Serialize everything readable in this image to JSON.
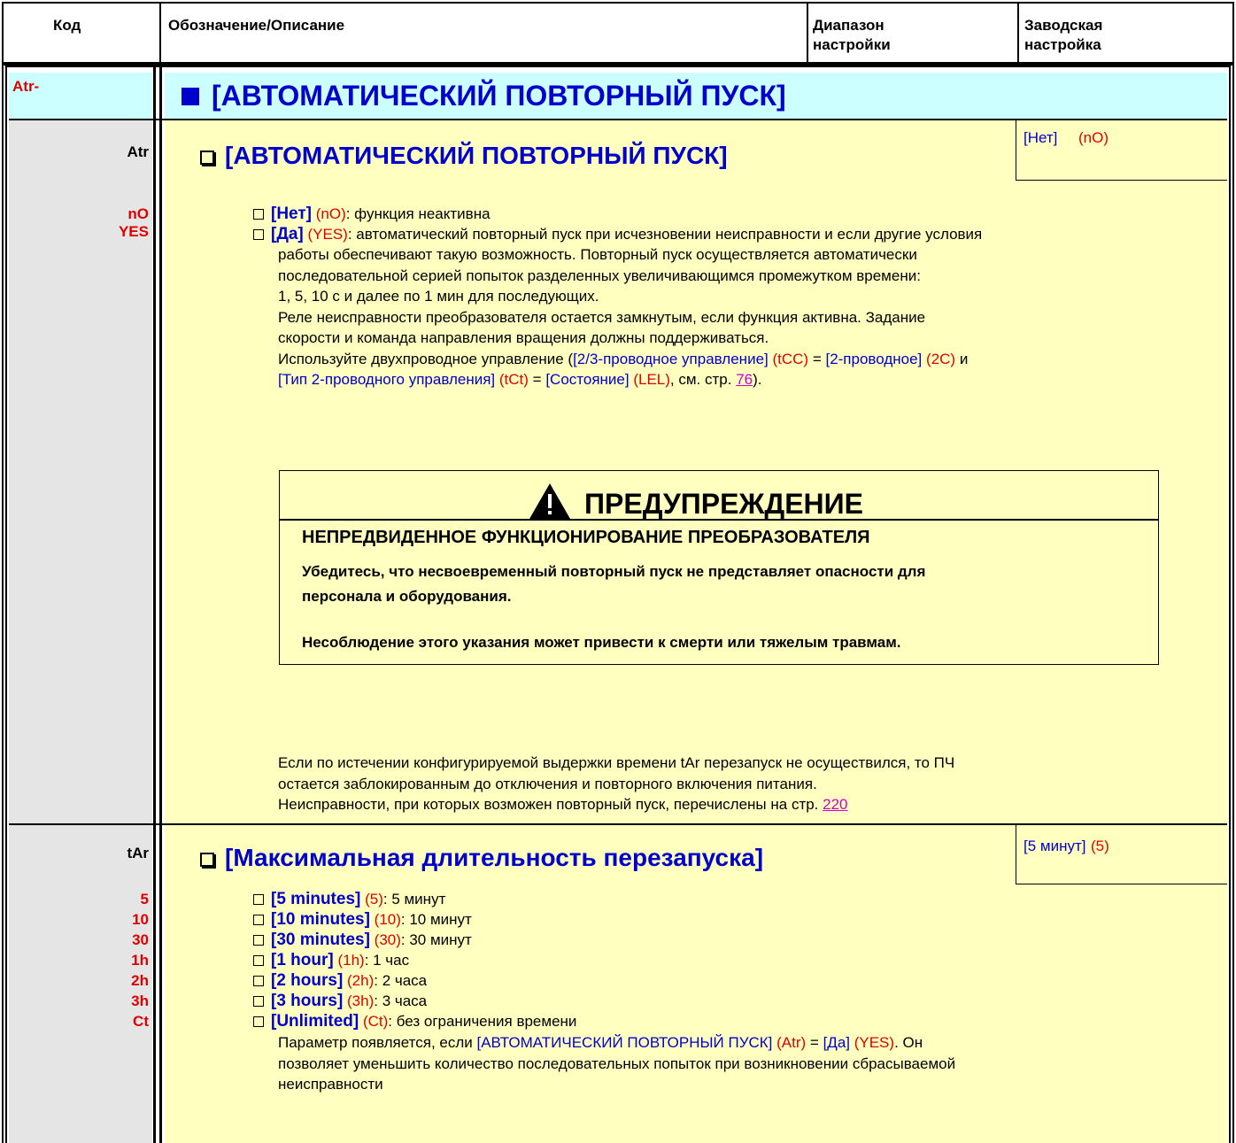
{
  "colors": {
    "yellow": "#ffffc0",
    "gray": "#e5e5e5",
    "cyan": "#ccffff",
    "blue": "#0000cc",
    "red": "#e00000",
    "link": "#cc00cc"
  },
  "header": {
    "col1": "Код",
    "col2": "Обозначение/Описание",
    "col3_line1": "Диапазон",
    "col3_line2": "настройки",
    "col4_line1": "Заводская",
    "col4_line2": "настройка"
  },
  "menu": {
    "code": "Atr-",
    "title": "[АВТОМАТИЧЕСКИЙ ПОВТОРНЫЙ ПУСК]"
  },
  "atr": {
    "code": "Atr",
    "codes": [
      "nO",
      "YES"
    ],
    "title": "[АВТОМАТИЧЕСКИЙ ПОВТОРНЫЙ ПУСК]",
    "factory_label": "[Нет]",
    "factory_code": "(nO)",
    "opt_no_label": "[Нет]",
    "opt_no_code": "(nO)",
    "opt_no_desc": ":  функция неактивна",
    "opt_yes_label": "[Да]",
    "opt_yes_code": "(YES)",
    "opt_yes_desc": ": автоматический повторный пуск при исчезновении неисправности и если другие условия",
    "lines": [
      "работы обеспечивают такую возможность. Повторный пуск осуществляется автоматически",
      "последовательной серией попыток разделенных увеличивающимся промежутком времени:",
      "1, 5, 10 с и далее по 1 мин для последующих.",
      "Реле неисправности преобразователя остается замкнутым, если функция активна. Задание",
      "скорости и команда направления вращения должны поддерживаться."
    ],
    "wire": {
      "p1": "Используйте двухпроводное управление (",
      "l1": "[2/3-проводное управление]",
      "c1": "(tCC)",
      "eq1": " = ",
      "l2": "[2-проводное]",
      "c2": "(2C)",
      "and": " и",
      "l3": "[Тип 2-проводного управления]",
      "c3": "(tCt)",
      "eq2": " = ",
      "l4": "[Состояние]",
      "c4": "(LEL)",
      "see": ", см. стр. ",
      "page": "76",
      "end": ")."
    },
    "warning": {
      "title": "ПРЕДУПРЕЖДЕНИЕ",
      "heading": "НЕПРЕДВИДЕННОЕ ФУНКЦИОНИРОВАНИЕ ПРЕОБРАЗОВАТЕЛЯ",
      "line1": "Убедитесь, что несвоевременный повторный пуск не представляет опасности для",
      "line2": "персонала и оборудования.",
      "line3": "Несоблюдение этого указания может привести к смерти или тяжелым травмам."
    },
    "after1": "Если по истечении конфигурируемой выдержки времени tAr перезапуск не осуществился, то ПЧ",
    "after2": "остается заблокированным до отключения и повторного включения питания.",
    "after3": "Неисправности, при которых возможен повторный пуск, перечислены на стр. ",
    "after3_page": "220"
  },
  "tar": {
    "code": "tAr",
    "codes": [
      "5",
      "10",
      "30",
      "1h",
      "2h",
      "3h",
      "Ct"
    ],
    "title": "[Максимальная длительность перезапуска]",
    "factory_label": "[5 минут]",
    "factory_code": "(5)",
    "options": [
      {
        "label": "[5 minutes]",
        "code": "(5)",
        "desc": ": 5 минут"
      },
      {
        "label": "[10 minutes]",
        "code": "(10)",
        "desc": ": 10 минут"
      },
      {
        "label": "[30 minutes]",
        "code": "(30)",
        "desc": ": 30 минут"
      },
      {
        "label": "[1 hour]",
        "code": "(1h)",
        "desc": ": 1 час"
      },
      {
        "label": "[2 hours]",
        "code": "(2h)",
        "desc": ": 2 часа"
      },
      {
        "label": "[3 hours]",
        "code": "(3h)",
        "desc": ": 3 часа"
      },
      {
        "label": "[Unlimited]",
        "code": "(Ct)",
        "desc": ": без ограничения времени"
      }
    ],
    "note": {
      "p1": "Параметр появляется, если ",
      "l1": "[АВТОМАТИЧЕСКИЙ ПОВТОРНЫЙ ПУСК]",
      "c1": " (Atr)",
      "eq": " = ",
      "l2": "[Да]",
      "c2": " (YES)",
      "p2": ". Он",
      "line2": "позволяет уменьшить количество последовательных попыток при возникновении сбрасываемой",
      "line3": "неисправности"
    }
  }
}
